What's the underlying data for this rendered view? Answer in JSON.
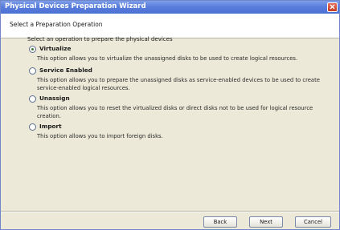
{
  "window": {
    "title": "Physical Devices Preparation Wizard",
    "close_icon": "close-icon"
  },
  "header": {
    "title": "Select a Preparation Operation"
  },
  "main": {
    "prompt": "Select an operation to prepare the physical devices",
    "selected_option": "Virtualize",
    "options": [
      {
        "label": "Virtualize",
        "description": "This option allows you to virtualize the unassigned disks to be used to create logical resources.",
        "selected": true
      },
      {
        "label": "Service Enabled",
        "description": "This option allows you to prepare the unassigned disks as service-enabled devices to be used to create service-enabled logical resources.",
        "selected": false
      },
      {
        "label": "Unassign",
        "description": "This option allows you to reset the virtualized disks or direct disks not to be used for logical resource creation.",
        "selected": false
      },
      {
        "label": "Import",
        "description": "This option allows you to import foreign disks.",
        "selected": false
      }
    ]
  },
  "footer": {
    "back_label": "Back",
    "next_label": "Next",
    "cancel_label": "Cancel"
  },
  "colors": {
    "titlebar": "#5b7fdc",
    "dialog_background": "#ece9d8",
    "selected_radio": "#3c7a3c"
  }
}
